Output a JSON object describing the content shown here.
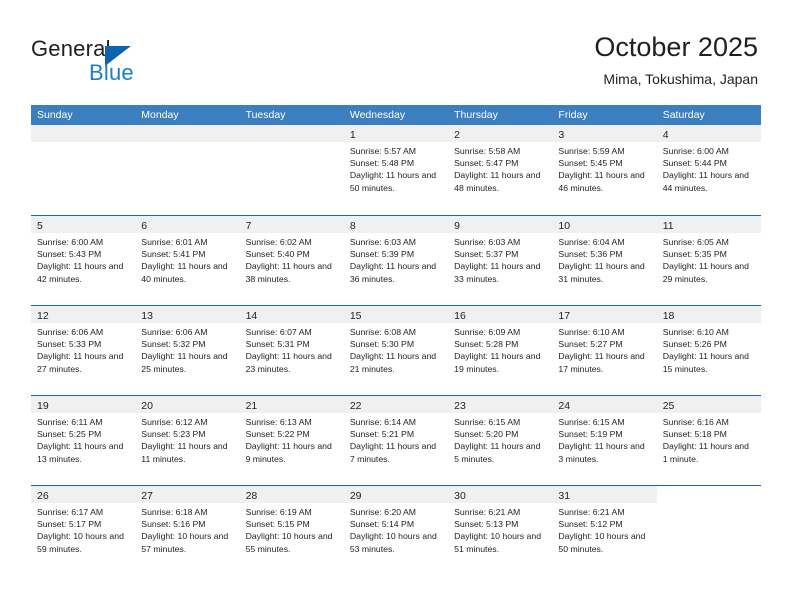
{
  "brand": {
    "name_part1": "General",
    "name_part2": "Blue",
    "logo_icon": "blue-triangle-logo"
  },
  "header": {
    "title": "October 2025",
    "location": "Mima, Tokushima, Japan"
  },
  "colors": {
    "header_blue": "#3b7fbf",
    "row_divider_blue": "#1b68ad",
    "daynum_band": "#f0f0f0",
    "brand_blue": "#1c7fc4",
    "logo_blue": "#0d64ad",
    "text": "#231f20"
  },
  "weekdays": [
    "Sunday",
    "Monday",
    "Tuesday",
    "Wednesday",
    "Thursday",
    "Friday",
    "Saturday"
  ],
  "weeks": [
    [
      {
        "day": "",
        "empty": true
      },
      {
        "day": "",
        "empty": true
      },
      {
        "day": "",
        "empty": true
      },
      {
        "day": "1",
        "sunrise": "Sunrise: 5:57 AM",
        "sunset": "Sunset: 5:48 PM",
        "daylight": "Daylight: 11 hours and 50 minutes."
      },
      {
        "day": "2",
        "sunrise": "Sunrise: 5:58 AM",
        "sunset": "Sunset: 5:47 PM",
        "daylight": "Daylight: 11 hours and 48 minutes."
      },
      {
        "day": "3",
        "sunrise": "Sunrise: 5:59 AM",
        "sunset": "Sunset: 5:45 PM",
        "daylight": "Daylight: 11 hours and 46 minutes."
      },
      {
        "day": "4",
        "sunrise": "Sunrise: 6:00 AM",
        "sunset": "Sunset: 5:44 PM",
        "daylight": "Daylight: 11 hours and 44 minutes."
      }
    ],
    [
      {
        "day": "5",
        "sunrise": "Sunrise: 6:00 AM",
        "sunset": "Sunset: 5:43 PM",
        "daylight": "Daylight: 11 hours and 42 minutes."
      },
      {
        "day": "6",
        "sunrise": "Sunrise: 6:01 AM",
        "sunset": "Sunset: 5:41 PM",
        "daylight": "Daylight: 11 hours and 40 minutes."
      },
      {
        "day": "7",
        "sunrise": "Sunrise: 6:02 AM",
        "sunset": "Sunset: 5:40 PM",
        "daylight": "Daylight: 11 hours and 38 minutes."
      },
      {
        "day": "8",
        "sunrise": "Sunrise: 6:03 AM",
        "sunset": "Sunset: 5:39 PM",
        "daylight": "Daylight: 11 hours and 36 minutes."
      },
      {
        "day": "9",
        "sunrise": "Sunrise: 6:03 AM",
        "sunset": "Sunset: 5:37 PM",
        "daylight": "Daylight: 11 hours and 33 minutes."
      },
      {
        "day": "10",
        "sunrise": "Sunrise: 6:04 AM",
        "sunset": "Sunset: 5:36 PM",
        "daylight": "Daylight: 11 hours and 31 minutes."
      },
      {
        "day": "11",
        "sunrise": "Sunrise: 6:05 AM",
        "sunset": "Sunset: 5:35 PM",
        "daylight": "Daylight: 11 hours and 29 minutes."
      }
    ],
    [
      {
        "day": "12",
        "sunrise": "Sunrise: 6:06 AM",
        "sunset": "Sunset: 5:33 PM",
        "daylight": "Daylight: 11 hours and 27 minutes."
      },
      {
        "day": "13",
        "sunrise": "Sunrise: 6:06 AM",
        "sunset": "Sunset: 5:32 PM",
        "daylight": "Daylight: 11 hours and 25 minutes."
      },
      {
        "day": "14",
        "sunrise": "Sunrise: 6:07 AM",
        "sunset": "Sunset: 5:31 PM",
        "daylight": "Daylight: 11 hours and 23 minutes."
      },
      {
        "day": "15",
        "sunrise": "Sunrise: 6:08 AM",
        "sunset": "Sunset: 5:30 PM",
        "daylight": "Daylight: 11 hours and 21 minutes."
      },
      {
        "day": "16",
        "sunrise": "Sunrise: 6:09 AM",
        "sunset": "Sunset: 5:28 PM",
        "daylight": "Daylight: 11 hours and 19 minutes."
      },
      {
        "day": "17",
        "sunrise": "Sunrise: 6:10 AM",
        "sunset": "Sunset: 5:27 PM",
        "daylight": "Daylight: 11 hours and 17 minutes."
      },
      {
        "day": "18",
        "sunrise": "Sunrise: 6:10 AM",
        "sunset": "Sunset: 5:26 PM",
        "daylight": "Daylight: 11 hours and 15 minutes."
      }
    ],
    [
      {
        "day": "19",
        "sunrise": "Sunrise: 6:11 AM",
        "sunset": "Sunset: 5:25 PM",
        "daylight": "Daylight: 11 hours and 13 minutes."
      },
      {
        "day": "20",
        "sunrise": "Sunrise: 6:12 AM",
        "sunset": "Sunset: 5:23 PM",
        "daylight": "Daylight: 11 hours and 11 minutes."
      },
      {
        "day": "21",
        "sunrise": "Sunrise: 6:13 AM",
        "sunset": "Sunset: 5:22 PM",
        "daylight": "Daylight: 11 hours and 9 minutes."
      },
      {
        "day": "22",
        "sunrise": "Sunrise: 6:14 AM",
        "sunset": "Sunset: 5:21 PM",
        "daylight": "Daylight: 11 hours and 7 minutes."
      },
      {
        "day": "23",
        "sunrise": "Sunrise: 6:15 AM",
        "sunset": "Sunset: 5:20 PM",
        "daylight": "Daylight: 11 hours and 5 minutes."
      },
      {
        "day": "24",
        "sunrise": "Sunrise: 6:15 AM",
        "sunset": "Sunset: 5:19 PM",
        "daylight": "Daylight: 11 hours and 3 minutes."
      },
      {
        "day": "25",
        "sunrise": "Sunrise: 6:16 AM",
        "sunset": "Sunset: 5:18 PM",
        "daylight": "Daylight: 11 hours and 1 minute."
      }
    ],
    [
      {
        "day": "26",
        "sunrise": "Sunrise: 6:17 AM",
        "sunset": "Sunset: 5:17 PM",
        "daylight": "Daylight: 10 hours and 59 minutes."
      },
      {
        "day": "27",
        "sunrise": "Sunrise: 6:18 AM",
        "sunset": "Sunset: 5:16 PM",
        "daylight": "Daylight: 10 hours and 57 minutes."
      },
      {
        "day": "28",
        "sunrise": "Sunrise: 6:19 AM",
        "sunset": "Sunset: 5:15 PM",
        "daylight": "Daylight: 10 hours and 55 minutes."
      },
      {
        "day": "29",
        "sunrise": "Sunrise: 6:20 AM",
        "sunset": "Sunset: 5:14 PM",
        "daylight": "Daylight: 10 hours and 53 minutes."
      },
      {
        "day": "30",
        "sunrise": "Sunrise: 6:21 AM",
        "sunset": "Sunset: 5:13 PM",
        "daylight": "Daylight: 10 hours and 51 minutes."
      },
      {
        "day": "31",
        "sunrise": "Sunrise: 6:21 AM",
        "sunset": "Sunset: 5:12 PM",
        "daylight": "Daylight: 10 hours and 50 minutes."
      },
      {
        "day": "",
        "empty": true,
        "no_band": true
      }
    ]
  ]
}
